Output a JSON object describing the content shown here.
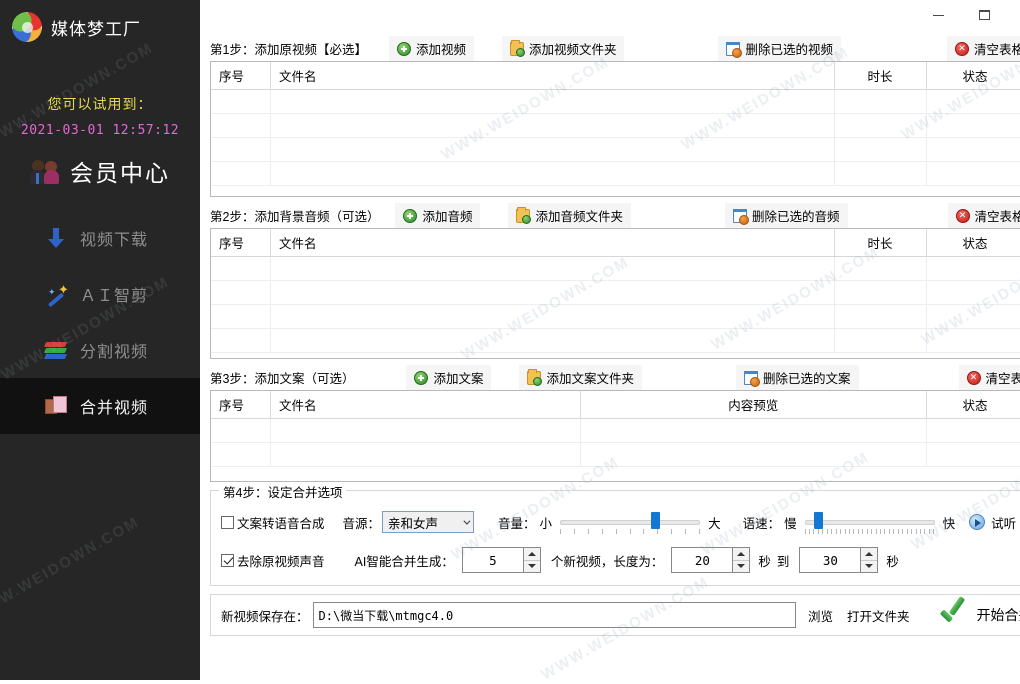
{
  "app": {
    "brand": "媒体梦工厂",
    "logo_icon": "app-logo-icon"
  },
  "sidebar": {
    "trial_label": "您可以试用到：",
    "trial_datetime": "2021-03-01 12:57:12",
    "vip_center": "会员中心",
    "items": [
      {
        "label": "视频下载",
        "icon": "download-arrow-icon",
        "active": false
      },
      {
        "label": "ＡＩ智剪",
        "icon": "magic-wand-icon",
        "active": false
      },
      {
        "label": "分割视频",
        "icon": "split-layers-icon",
        "active": false
      },
      {
        "label": "合并视频",
        "icon": "merge-squares-icon",
        "active": true
      }
    ]
  },
  "titlebar": {
    "minimize": "–",
    "maximize": "□",
    "close": "✕"
  },
  "steps": [
    {
      "title": "第1步：添加原视频【必选】",
      "add_file": "添加视频",
      "add_folder": "添加视频文件夹",
      "delete_selected": "删除已选的视频",
      "clear_table": "清空表格",
      "columns": [
        "序号",
        "文件名",
        "时长",
        "状态"
      ]
    },
    {
      "title": "第2步：添加背景音频（可选）",
      "add_file": "添加音频",
      "add_folder": "添加音频文件夹",
      "delete_selected": "删除已选的音频",
      "clear_table": "清空表格",
      "columns": [
        "序号",
        "文件名",
        "时长",
        "状态"
      ]
    },
    {
      "title": "第3步：添加文案（可选）",
      "add_file": "添加文案",
      "add_folder": "添加文案文件夹",
      "delete_selected": "删除已选的文案",
      "clear_table": "清空表格",
      "columns": [
        "序号",
        "文件名",
        "内容预览",
        "状态"
      ]
    }
  ],
  "step4": {
    "legend": "第4步：设定合并选项",
    "tts_checkbox_label": "文案转语音合成",
    "tts_checked": false,
    "voice_source_label": "音源：",
    "voice_source_value": "亲和女声",
    "volume_label": "音量：",
    "volume_min_label": "小",
    "volume_max_label": "大",
    "volume_percent": 68,
    "speed_label": "语速：",
    "speed_min_label": "慢",
    "speed_max_label": "快",
    "speed_percent": 10,
    "preview_label": "试听",
    "remove_audio_label": "去除原视频声音",
    "remove_audio_checked": true,
    "ai_merge_label": "AI智能合并生成：",
    "ai_merge_count": "5",
    "new_video_label": "个新视频，长度为：",
    "length_min": "20",
    "unit_seconds_1": "秒",
    "range_to": "到",
    "length_max": "30",
    "unit_seconds_2": "秒"
  },
  "bottom": {
    "save_path_label": "新视频保存在：",
    "save_path_value": "D:\\微当下载\\mtmgc4.0",
    "browse_label": "浏览",
    "open_folder_label": "打开文件夹",
    "start_label": "开始合并",
    "start_icon": "green-check-icon"
  },
  "watermark": {
    "text": "WWW.WEIDOWN.COM"
  },
  "colors": {
    "sidebar_bg": "#262626",
    "sidebar_active_bg": "#111111",
    "trial_yellow": "#e8d84a",
    "trial_pink": "#e06ad2",
    "accent_blue": "#1478d2",
    "green": "#2f9e3a",
    "red": "#c41f17"
  }
}
